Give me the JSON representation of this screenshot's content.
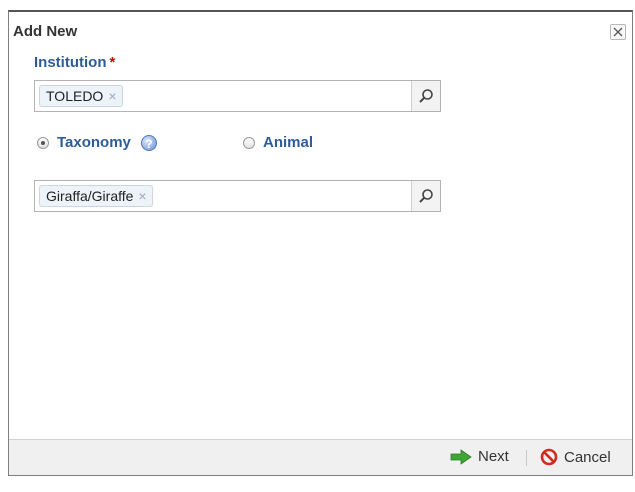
{
  "dialog": {
    "title": "Add New"
  },
  "institution": {
    "label": "Institution",
    "required_mark": "*",
    "selected_tag": "TOLEDO",
    "tag_remove": "×"
  },
  "selection_type": {
    "options": [
      {
        "label": "Taxonomy",
        "selected": true,
        "help": "?"
      },
      {
        "label": "Animal",
        "selected": false
      }
    ]
  },
  "taxonomy": {
    "selected_tag": "Giraffa/Giraffe",
    "tag_remove": "×"
  },
  "footer": {
    "next_label": "Next",
    "cancel_label": "Cancel"
  },
  "colors": {
    "label_blue": "#2e5c9a",
    "required_red": "#d00000",
    "next_green": "#3fa535",
    "cancel_red": "#d22b1f"
  }
}
